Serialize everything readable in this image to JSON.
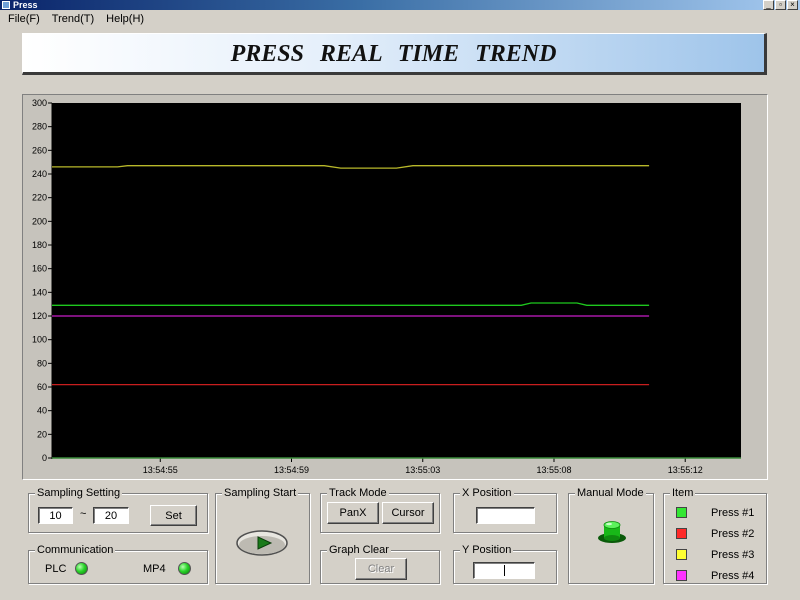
{
  "window": {
    "title": "Press",
    "controls": [
      "_",
      "▫",
      "×"
    ]
  },
  "menu": [
    "File(F)",
    "Trend(T)",
    "Help(H)"
  ],
  "banner": {
    "title": "PRESS REAL TIME TREND"
  },
  "colors": {
    "plot_bg": "#000000",
    "press1": "#1ec81e",
    "press2": "#c81e1e",
    "press3": "#b8b82a",
    "press4": "#c81ec8",
    "legend_press1": "#33e633",
    "legend_press2": "#ff2a2a",
    "legend_press3": "#ffff33",
    "legend_press4": "#ff33ff"
  },
  "chart_data": {
    "type": "line",
    "ylim": [
      0,
      300
    ],
    "yticks": [
      0,
      20,
      40,
      60,
      80,
      100,
      120,
      140,
      160,
      180,
      200,
      220,
      240,
      260,
      280,
      300
    ],
    "xlim": [
      0,
      21
    ],
    "xticks": [
      {
        "x": 3.3,
        "label": "13:54:55"
      },
      {
        "x": 7.3,
        "label": "13:54:59"
      },
      {
        "x": 11.3,
        "label": "13:55:03"
      },
      {
        "x": 15.3,
        "label": "13:55:08"
      },
      {
        "x": 19.3,
        "label": "13:55:12"
      }
    ],
    "series": [
      {
        "color_key": "press3",
        "x": [
          0,
          2,
          2.3,
          8.3,
          8.8,
          10.5,
          11,
          18.2
        ],
        "y": [
          246,
          246,
          247,
          247,
          245,
          245,
          247,
          247
        ]
      },
      {
        "color_key": "press1",
        "x": [
          0,
          14.3,
          14.6,
          16,
          16.3,
          18.2
        ],
        "y": [
          129,
          129,
          131,
          131,
          129,
          129
        ]
      },
      {
        "color_key": "press4",
        "x": [
          0,
          18.2
        ],
        "y": [
          120,
          120
        ]
      },
      {
        "color_key": "press2",
        "x": [
          0,
          18.2
        ],
        "y": [
          62,
          62
        ]
      }
    ]
  },
  "sampling": {
    "title": "Sampling Setting",
    "from": "10",
    "separator": "~",
    "to": "20",
    "set_label": "Set"
  },
  "communication": {
    "title": "Communication",
    "plc": "PLC",
    "mp4": "MP4"
  },
  "sampling_start": {
    "title": "Sampling Start"
  },
  "track_mode": {
    "title": "Track Mode",
    "panx": "PanX",
    "cursor": "Cursor"
  },
  "graph_clear": {
    "title": "Graph Clear",
    "clear": "Clear"
  },
  "x_position": {
    "title": "X Position",
    "value": ""
  },
  "y_position": {
    "title": "Y Position",
    "value": ""
  },
  "manual_mode": {
    "title": "Manual Mode"
  },
  "items": {
    "title": "Item",
    "list": [
      {
        "label": "Press #1",
        "color_key": "legend_press1"
      },
      {
        "label": "Press #2",
        "color_key": "legend_press2"
      },
      {
        "label": "Press #3",
        "color_key": "legend_press3"
      },
      {
        "label": "Press #4",
        "color_key": "legend_press4"
      }
    ]
  }
}
